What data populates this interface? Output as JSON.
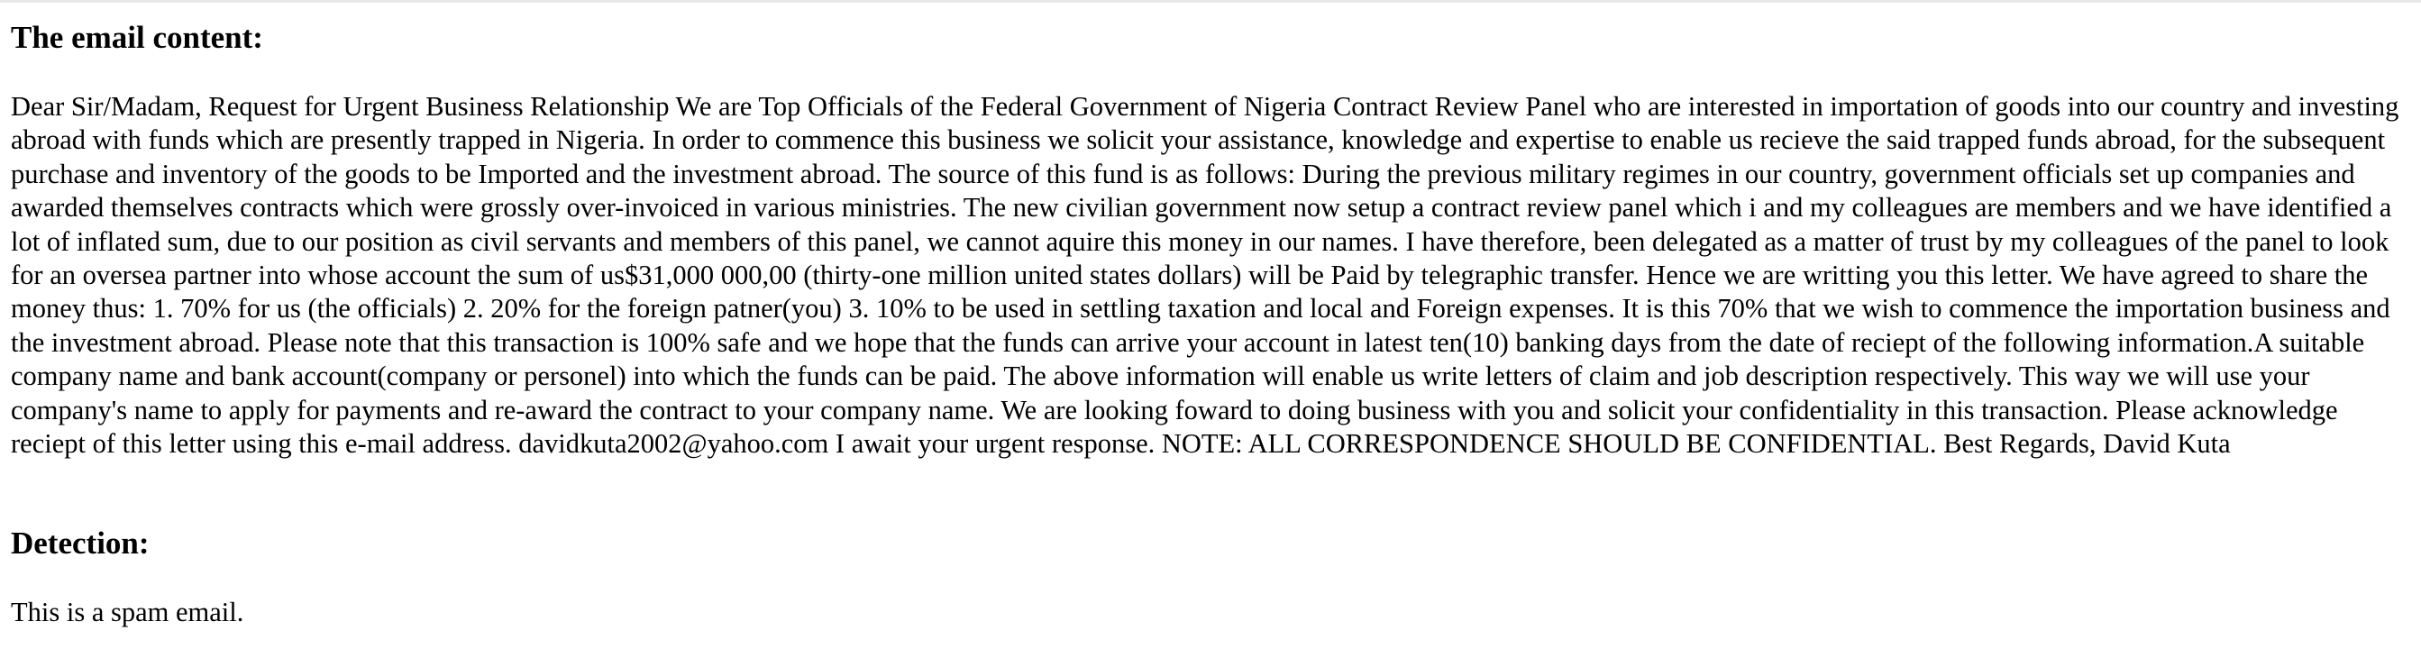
{
  "sections": {
    "email_heading": "The email content:",
    "email_body": "Dear Sir/Madam, Request for Urgent Business Relationship We are Top Officials of the Federal Government of Nigeria Contract Review Panel who are interested in importation of goods into our country and investing abroad with funds which are presently trapped in Nigeria. In order to commence this business we solicit your assistance, knowledge and expertise to enable us recieve the said trapped funds abroad, for the subsequent purchase and inventory of the goods to be Imported and the investment abroad. The source of this fund is as follows: During the previous military regimes in our country, government officials set up companies and awarded themselves contracts which were grossly over-invoiced in various ministries. The new civilian government now setup a contract review panel which i and my colleagues are members and we have identified a lot of inflated sum, due to our position as civil servants and members of this panel, we cannot aquire this money in our names. I have therefore, been delegated as a matter of trust by my colleagues of the panel to look for an oversea partner into whose account the sum of us$31,000 000,00 (thirty-one million united states dollars) will be Paid by telegraphic transfer. Hence we are writting you this letter. We have agreed to share the money thus: 1. 70% for us (the officials) 2. 20% for the foreign patner(you) 3. 10% to be used in settling taxation and local and Foreign expenses. It is this 70% that we wish to commence the importation business and the investment abroad. Please note that this transaction is 100% safe and we hope that the funds can arrive your account in latest ten(10) banking days from the date of reciept of the following information.A suitable company name and bank account(company or personel) into which the funds can be paid. The above information will enable us write letters of claim and job description respectively. This way we will use your company's name to apply for payments and re-award the contract to your company name. We are looking foward to doing business with you and solicit your confidentiality in this transaction. Please acknowledge reciept of this letter using this e-mail address. davidkuta2002@yahoo.com I await your urgent response. NOTE: ALL CORRESPONDENCE SHOULD BE CONFIDENTIAL. Best Regards, David Kuta",
    "detection_heading": "Detection:",
    "detection_result": "This is a spam email."
  }
}
